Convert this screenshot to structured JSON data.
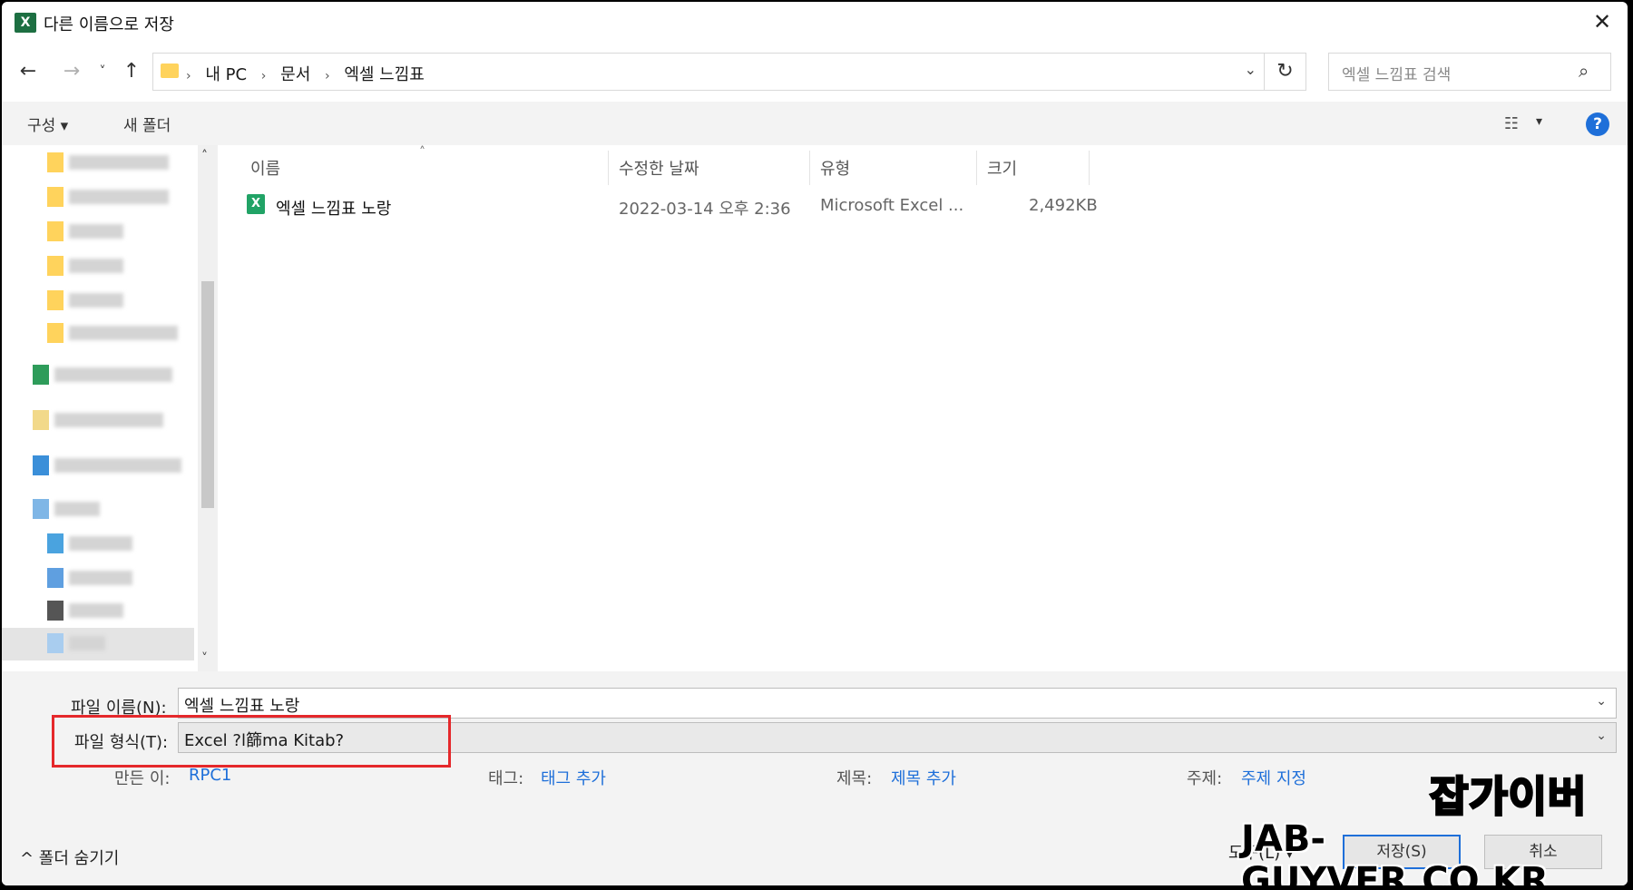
{
  "window": {
    "title": "다른 이름으로 저장",
    "app_icon_letter": "X"
  },
  "nav": {
    "back_icon": "←",
    "forward_icon": "→",
    "recent_icon": "˅",
    "up_icon": "↑",
    "breadcrumb": [
      "내 PC",
      "문서",
      "엑셀 느낌표"
    ],
    "separator": "›",
    "refresh_icon": "↻",
    "search_placeholder": "엑셀 느낌표 검색",
    "search_icon": "⌕"
  },
  "toolbar": {
    "organize_label": "구성 ▾",
    "new_folder_label": "새 폴더",
    "help_label": "?"
  },
  "columns": {
    "name": "이름",
    "modified": "수정한 날짜",
    "type": "유형",
    "size": "크기"
  },
  "files": [
    {
      "name": "엑셀 느낌표 노랑",
      "modified": "2022-03-14 오후 2:36",
      "type": "Microsoft Excel ...",
      "size": "2,492KB"
    }
  ],
  "form": {
    "filename_label": "파일 이름(N):",
    "filename_value": "엑셀 느낌표 노랑",
    "filetype_label": "파일 형식(T):",
    "filetype_value": "Excel ?l篩ma Kitab?"
  },
  "meta": {
    "author_label": "만든 이:",
    "author_value": "RPC1",
    "tags_label": "태그:",
    "tags_value": "태그 추가",
    "title_label": "제목:",
    "title_value": "제목 추가",
    "subject_label": "주제:",
    "subject_value": "주제 지정"
  },
  "footer": {
    "hide_folders": "^ 폴더 숨기기",
    "tools_label": "도구(L) ▾",
    "save_label": "저장(S)",
    "cancel_label": "취소"
  },
  "watermark": {
    "line1": "잡가이버",
    "line2": "JAB-GUYVER.CO.KR"
  },
  "colors": {
    "accent": "#1e6fd9",
    "highlight_box": "#e5282b",
    "excel_green": "#21a366"
  }
}
